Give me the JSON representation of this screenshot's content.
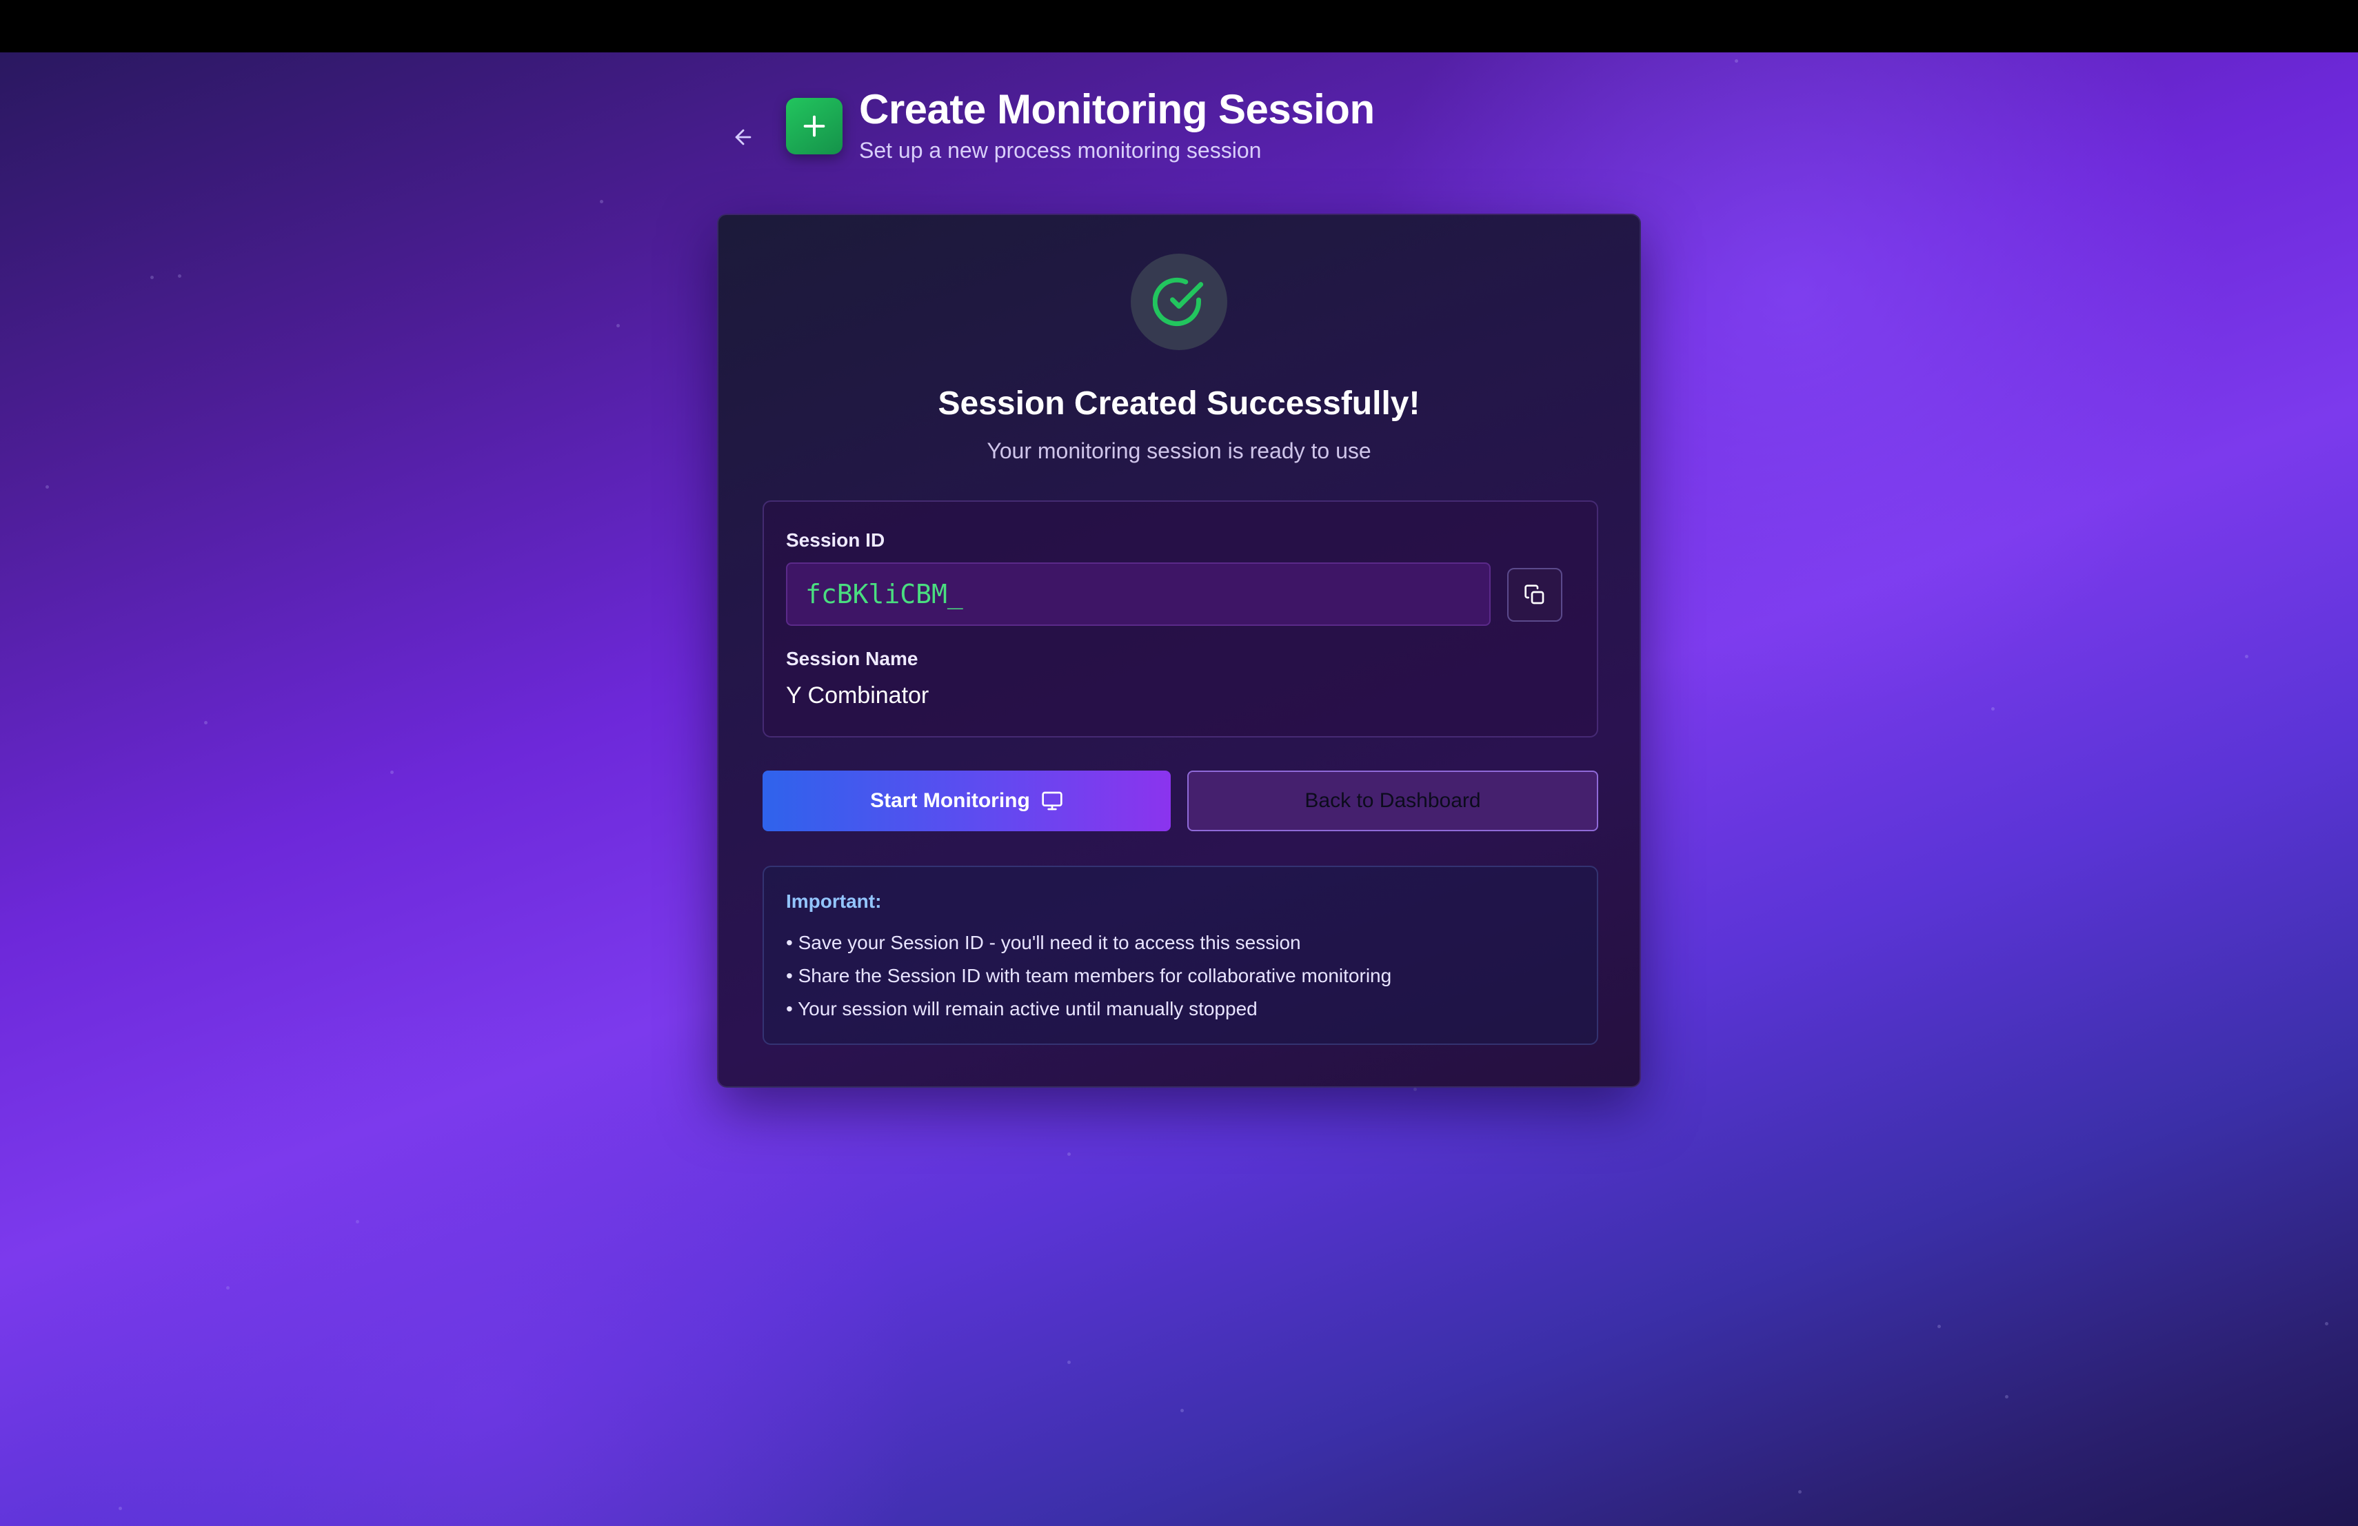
{
  "header": {
    "title": "Create Monitoring Session",
    "subtitle": "Set up a new process monitoring session"
  },
  "card": {
    "success_title": "Session Created Successfully!",
    "success_subtitle": "Your monitoring session is ready to use",
    "session_id_label": "Session ID",
    "session_id_value": "fcBKliCBM_",
    "session_name_label": "Session Name",
    "session_name_value": "Y Combinator",
    "start_button_label": "Start Monitoring",
    "back_button_label": "Back to Dashboard",
    "notice_title": "Important:",
    "notice_items": [
      "• Save your Session ID - you'll need it to access this session",
      "• Share the Session ID with team members for collaborative monitoring",
      "• Your session will remain active until manually stopped"
    ]
  },
  "icons": {
    "back": "arrow-left-icon",
    "logo": "plus-icon",
    "success": "check-circle-icon",
    "copy": "copy-icon",
    "monitor": "monitor-icon"
  },
  "colors": {
    "accent_green": "#22c55e",
    "session_id_text": "#4ade80",
    "notice_title": "#93c5fd",
    "start_gradient_from": "#2f63ec",
    "start_gradient_to": "#8b34ee"
  }
}
